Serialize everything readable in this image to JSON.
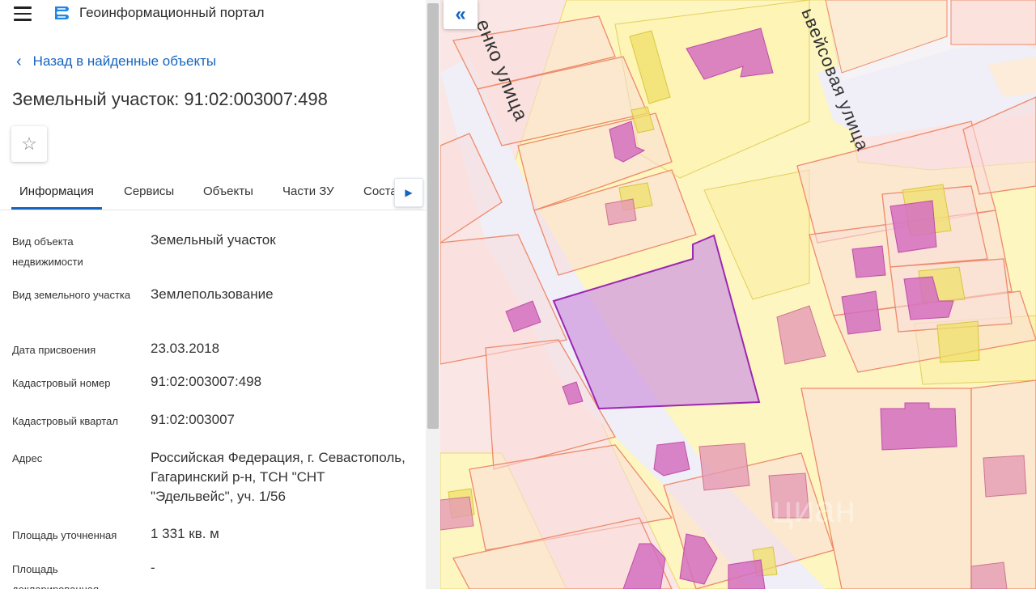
{
  "header": {
    "menu_icon": "menu-icon",
    "logo_icon": "portal-logo-icon",
    "title": "Геоинформационный портал"
  },
  "nav": {
    "back_label": "Назад в найденные объекты"
  },
  "object": {
    "title": "Земельный участок: 91:02:003007:498",
    "favorite_icon": "star-outline-icon"
  },
  "tabs": [
    {
      "label": "Информация",
      "active": true
    },
    {
      "label": "Сервисы",
      "active": false
    },
    {
      "label": "Объекты",
      "active": false
    },
    {
      "label": "Части ЗУ",
      "active": false
    },
    {
      "label": "Соста",
      "active": false
    }
  ],
  "properties": [
    {
      "label": "Вид объекта недвижимости",
      "value": "Земельный участок"
    },
    {
      "label": "Вид земельного участка",
      "value": "Землепользование"
    },
    {
      "label": "Дата присвоения",
      "value": "23.03.2018"
    },
    {
      "label": "Кадастровый номер",
      "value": "91:02:003007:498"
    },
    {
      "label": "Кадастровый квартал",
      "value": "91:02:003007"
    },
    {
      "label": "Адрес",
      "value": "Российская Федерация, г. Севастополь, Гагаринский р-н, ТСН \"СНТ \"Эдельвейс\", уч. 1/56"
    },
    {
      "label": "Площадь уточненная",
      "value": "1 331 кв. м"
    },
    {
      "label": "Площадь декларированная",
      "value": "-"
    }
  ],
  "map": {
    "streets": [
      "енко улица",
      "ьвейсовая улица"
    ],
    "colors": {
      "parcel_fill": "#f7d3d3",
      "parcel_stroke": "#ee8a6a",
      "zone_fill": "#fdf5b8",
      "zone_stroke": "#e8d54a",
      "building_fill": "#d46fbf",
      "selected_fill": "#d9a4d9",
      "selected_stroke": "#9c27b0",
      "road": "#f1f0f6"
    }
  },
  "accent": "#1565c0"
}
